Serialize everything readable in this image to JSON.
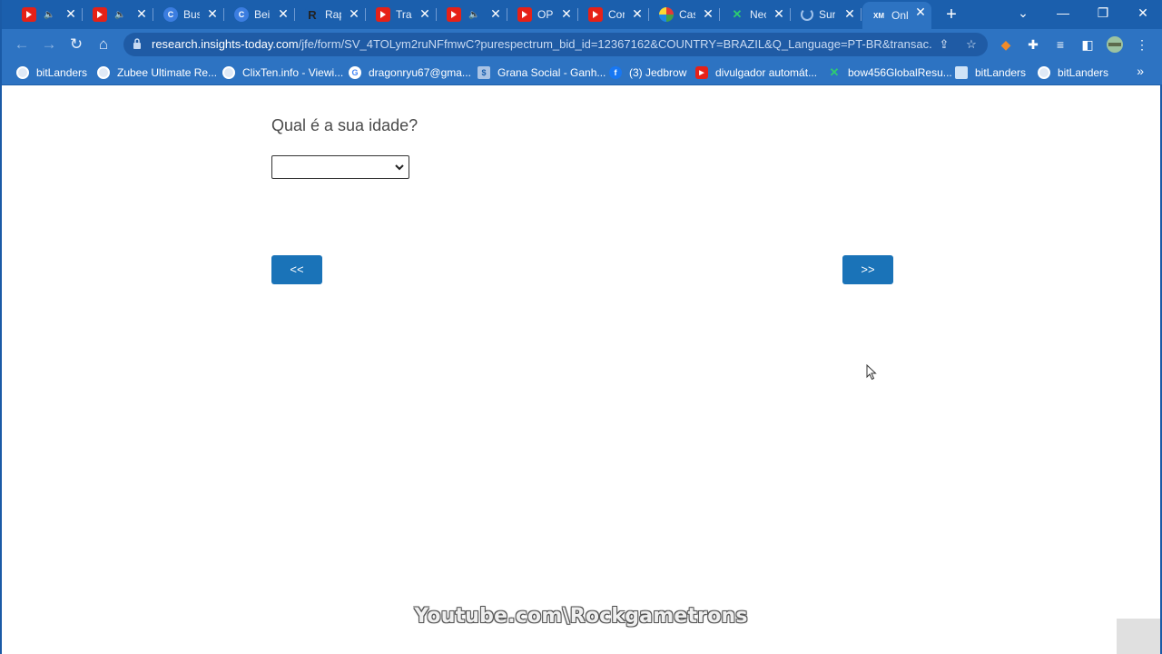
{
  "browser": {
    "tabs": [
      {
        "title": "",
        "icon": "youtube-icon",
        "audio": true
      },
      {
        "title": "",
        "icon": "youtube-icon",
        "audio": true
      },
      {
        "title": "Bus",
        "icon": "clixten-icon",
        "audio": false
      },
      {
        "title": "Bei",
        "icon": "clixten-icon",
        "audio": false
      },
      {
        "title": "Rap",
        "icon": "r-icon",
        "audio": false
      },
      {
        "title": "Tra",
        "icon": "youtube-icon",
        "audio": false
      },
      {
        "title": "",
        "icon": "youtube-icon",
        "audio": true
      },
      {
        "title": "OPI",
        "icon": "youtube-icon",
        "audio": false
      },
      {
        "title": "Cor",
        "icon": "youtube-icon",
        "audio": false
      },
      {
        "title": "Cas",
        "icon": "pinwheel-icon",
        "audio": false
      },
      {
        "title": "Nec",
        "icon": "x-logo-icon",
        "audio": false
      },
      {
        "title": "Sur",
        "icon": "loading-icon",
        "audio": false
      },
      {
        "title": "Onl",
        "icon": "xm-icon",
        "audio": false,
        "active": true
      }
    ],
    "close_glyph": "✕",
    "new_tab_glyph": "+",
    "url_host": "research.insights-today.com",
    "url_rest": "/jfe/form/SV_4TOLym2ruNFfmwC?purespectrum_bid_id=12367162&COUNTRY=BRAZIL&Q_Language=PT-BR&transac...",
    "bookmarks": [
      {
        "label": "bitLanders",
        "icon": "globe-icon"
      },
      {
        "label": "Zubee Ultimate Re...",
        "icon": "globe-icon"
      },
      {
        "label": "ClixTen.info - Viewi...",
        "icon": "globe-icon"
      },
      {
        "label": "dragonryu67@gma...",
        "icon": "google-icon"
      },
      {
        "label": "Grana Social - Ganh...",
        "icon": "grana-icon"
      },
      {
        "label": "(3) Jedbrow",
        "icon": "facebook-icon"
      },
      {
        "label": "divulgador automát...",
        "icon": "youtube-icon"
      },
      {
        "label": "bow456GlobalResu...",
        "icon": "x-logo-icon"
      },
      {
        "label": "bitLanders",
        "icon": "image-icon"
      },
      {
        "label": "bitLanders",
        "icon": "globe-icon"
      }
    ],
    "more_bookmarks": "»",
    "colors": {
      "frame": "#1b5fad",
      "toolbar": "#2d73c2",
      "accent_button": "#1a73b8"
    }
  },
  "survey": {
    "question": "Qual é a sua idade?",
    "select_value": "",
    "prev_label": "<<",
    "next_label": ">>"
  },
  "overlay": {
    "watermark": "Youtube.com\\Rockgametrons"
  }
}
